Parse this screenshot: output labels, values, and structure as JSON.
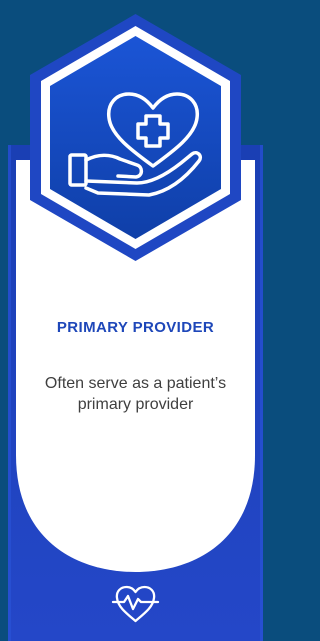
{
  "card": {
    "title": "PRIMARY PROVIDER",
    "description": "Often serve as a patient’s primary provider"
  },
  "icons": {
    "main": "hand-holding-heart-icon",
    "footer": "heart-pulse-icon"
  },
  "colors": {
    "page_background": "#0a4d7d",
    "card_background": "#ffffff",
    "card_blue_edge": "#1f43c9",
    "hexagon_fill": "#1649c8",
    "title_text": "#1e47b9",
    "description_text": "#3f3f3f"
  }
}
